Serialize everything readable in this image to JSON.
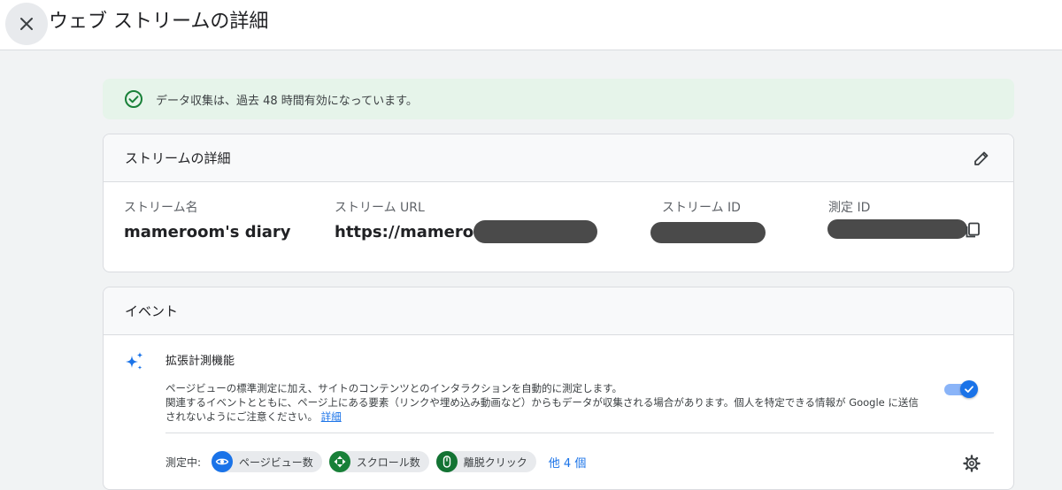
{
  "topbar": {
    "title": "ウェブ ストリームの詳細",
    "close_icon": "close-icon"
  },
  "banner": {
    "text": "データ収集は、過去 48 時間有効になっています。",
    "icon": "check-circle-icon",
    "accent": "#188038"
  },
  "stream_details": {
    "title": "ストリームの詳細",
    "edit_icon": "pencil-icon",
    "fields": {
      "name": {
        "label": "ストリーム名",
        "value": "mameroom's diary"
      },
      "url": {
        "label": "ストリーム URL",
        "value": "https://mameroom"
      },
      "id": {
        "label": "ストリーム ID",
        "value": ""
      },
      "measurement_id": {
        "label": "測定 ID",
        "value": ""
      }
    },
    "copy_icon": "copy-icon"
  },
  "events": {
    "title": "イベント",
    "enhanced": {
      "icon": "sparkle-icon",
      "title": "拡張計測機能",
      "desc_line1": "ページビューの標準測定に加え、サイトのコンテンツとのインタラクションを自動的に測定します。",
      "desc_line2": "関連するイベントとともに、ページ上にある要素（リンクや埋め込み動画など）からもデータが収集される場合があります。個人を特定できる情報が Google に送信",
      "desc_line3": "されないようにご注意ください。",
      "details_link": "詳細",
      "enabled": true
    },
    "measuring": {
      "label": "測定中:",
      "chips": [
        {
          "label": "ページビュー数",
          "icon": "eye-icon",
          "color": "#1a73e8"
        },
        {
          "label": "スクロール数",
          "icon": "crosshair-icon",
          "color": "#188038"
        },
        {
          "label": "離脱クリック",
          "icon": "mouse-icon",
          "color": "#137333"
        }
      ],
      "more": "他 4 個",
      "settings_icon": "gear-icon"
    }
  }
}
